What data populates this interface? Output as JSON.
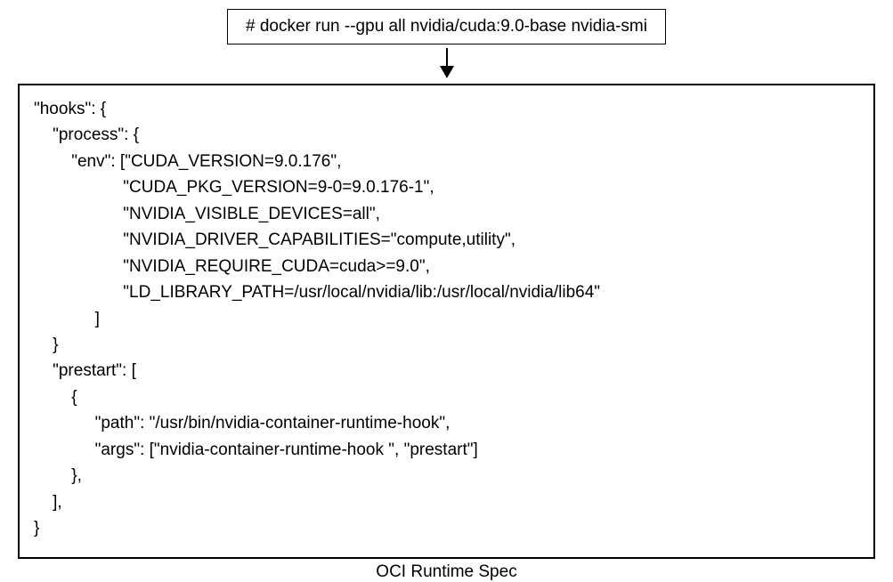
{
  "command": "# docker run --gpu all nvidia/cuda:9.0-base nvidia-smi",
  "spec": {
    "hooks_key": "\"hooks\": {",
    "process_key": "    \"process\": {",
    "env_key": "        \"env\": [",
    "env_items": [
      "\"CUDA_VERSION=9.0.176\",",
      "                   \"CUDA_PKG_VERSION=9-0=9.0.176-1\",",
      "                   \"NVIDIA_VISIBLE_DEVICES=all\",",
      "                   \"NVIDIA_DRIVER_CAPABILITIES=\"compute,utility\",",
      "                   \"NVIDIA_REQUIRE_CUDA=cuda>=9.0\",",
      "                   \"LD_LIBRARY_PATH=/usr/local/nvidia/lib:/usr/local/nvidia/lib64\""
    ],
    "env_close": "             ]",
    "process_close": "    }",
    "prestart_key": "    \"prestart\": [",
    "prestart_open": "        {",
    "prestart_path": "             \"path\": \"/usr/bin/nvidia-container-runtime-hook\",",
    "prestart_args": "             \"args\": [\"nvidia-container-runtime-hook \", \"prestart\"]",
    "prestart_obj_close": "        },",
    "prestart_close": "    ],",
    "hooks_close": "}"
  },
  "caption": "OCI Runtime Spec"
}
